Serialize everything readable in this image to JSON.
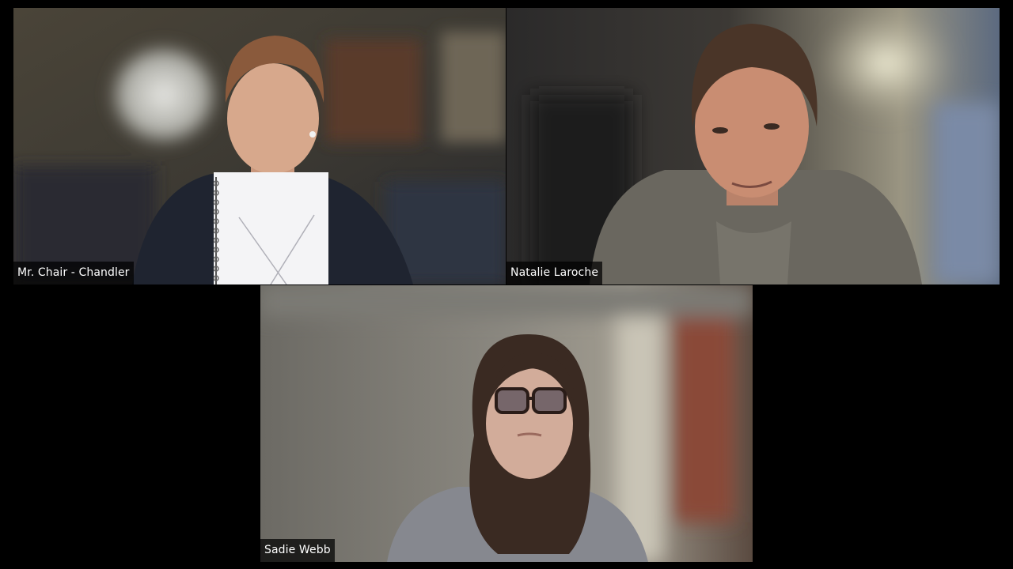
{
  "meeting": {
    "view": "gallery",
    "participants": [
      {
        "name": "Mr. Chair - Chandler",
        "video": "on",
        "prop": "notebook-with-x-sketch"
      },
      {
        "name": "Natalie Laroche",
        "video": "on",
        "speaking": true
      },
      {
        "name": "Sadie Webb",
        "video": "on"
      }
    ]
  },
  "colors": {
    "background": "#000000",
    "label_bg": "rgba(0,0,0,0.72)",
    "label_text": "#ffffff"
  }
}
